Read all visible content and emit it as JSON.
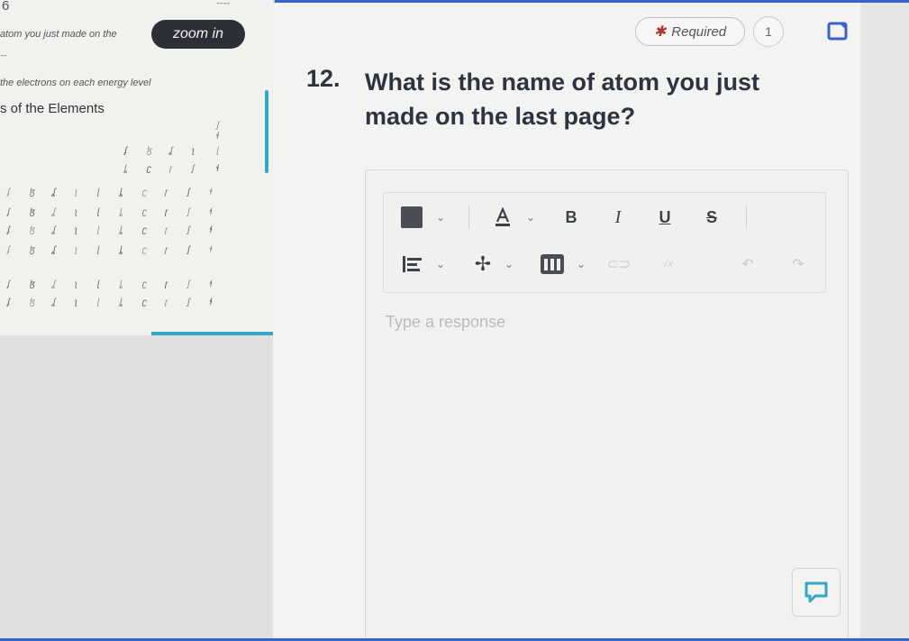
{
  "left_panel": {
    "top_glyph": "6",
    "top_label": "ˉˉˉˉ",
    "instruction_1": "atom you just made on the",
    "zoom_label": "zoom in",
    "small_mark": "ˉˉ",
    "instruction_2": "the electrons on each energy level",
    "heading": "s of the Elements"
  },
  "question": {
    "number": "12.",
    "text": "What is the name of atom you just made on the last page?",
    "required_label": "Required",
    "points": "1"
  },
  "toolbar": {
    "font_color_icon": "text-color-icon",
    "bold_label": "B",
    "italic_label": "I",
    "underline_label": "U",
    "strike_label": "S",
    "align_icon": "align-left-icon",
    "insert_icon": "plus-icon",
    "table_icon": "table-icon"
  },
  "editor": {
    "placeholder": "Type a response"
  },
  "colors": {
    "accent": "#3a63c9",
    "teal": "#34a6c7",
    "required_star": "#b4332f",
    "swatch": "#4a4e54"
  }
}
